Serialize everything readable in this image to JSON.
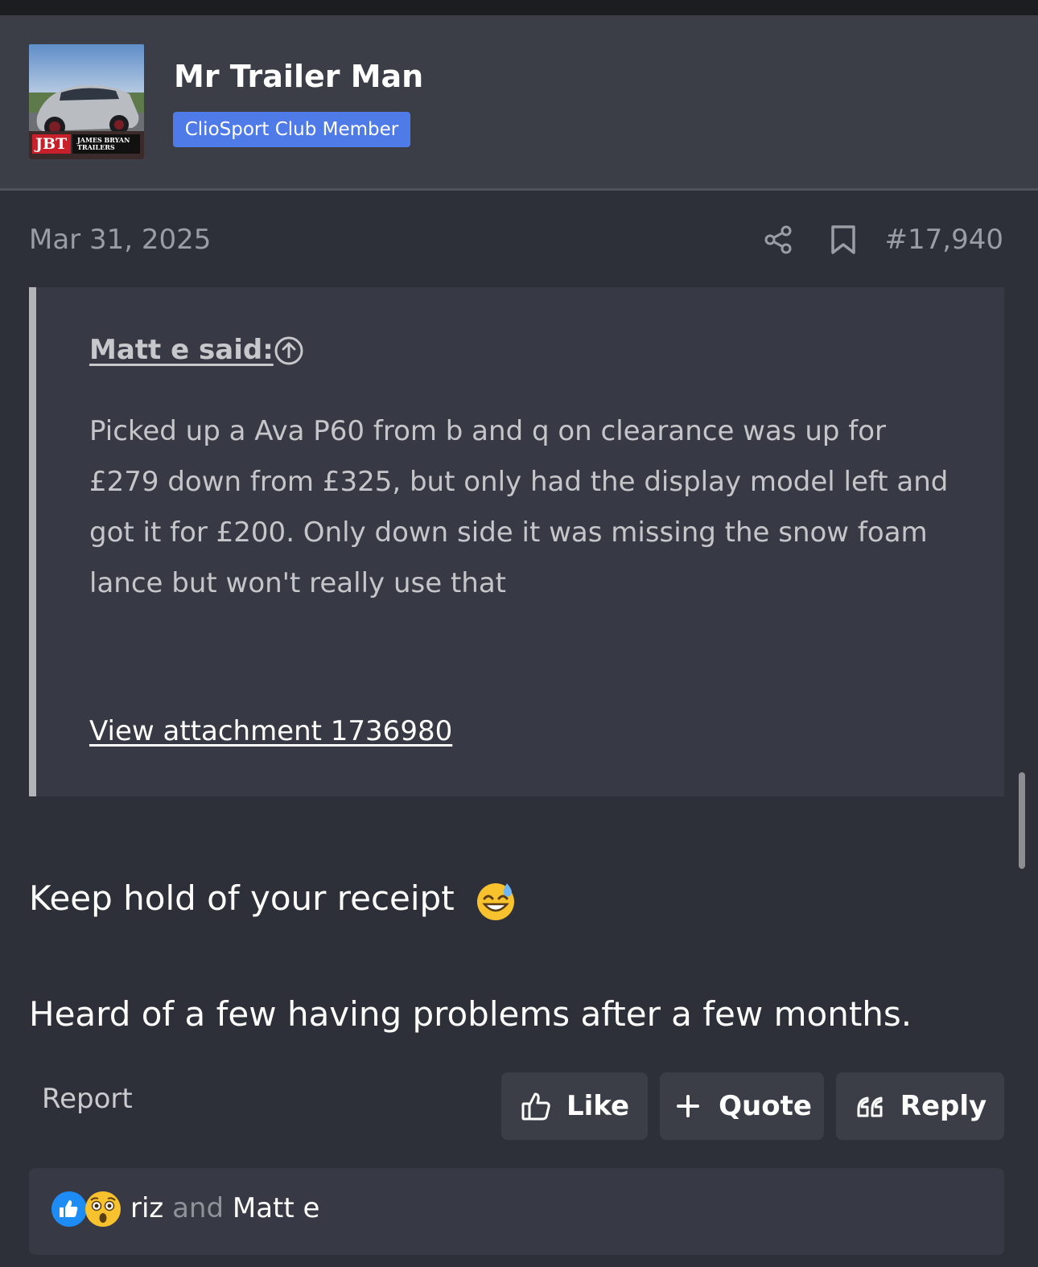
{
  "user": {
    "name": "Mr Trailer Man",
    "badge": "ClioSport Club Member",
    "avatar_caption_left": "JBT",
    "avatar_caption_right": "JAMES BRYAN TRAILERS"
  },
  "post": {
    "date": "Mar 31, 2025",
    "number": "#17,940",
    "quote": {
      "author": "Matt e said:",
      "text": "Picked up a Ava P60 from b and q on clearance was up for £279 down from £325, but only had the display model left and got it for £200. Only down side it was missing the snow foam lance but won't really use that",
      "attachment_link": "View attachment 1736980"
    },
    "message_line1": "Keep hold of your receipt",
    "message_line2": "Heard of a few having problems after a few months."
  },
  "actions": {
    "report": "Report",
    "like": "Like",
    "quote": "Quote",
    "reply": "Reply"
  },
  "reactions": {
    "user1": "riz",
    "joiner": "and",
    "user2": "Matt e"
  },
  "colors": {
    "background": "#2d3038",
    "header_bg": "#3b3e47",
    "badge": "#4f7be8",
    "like_blue": "#1d8cf5",
    "wow_yellow": "#f7c22d"
  }
}
